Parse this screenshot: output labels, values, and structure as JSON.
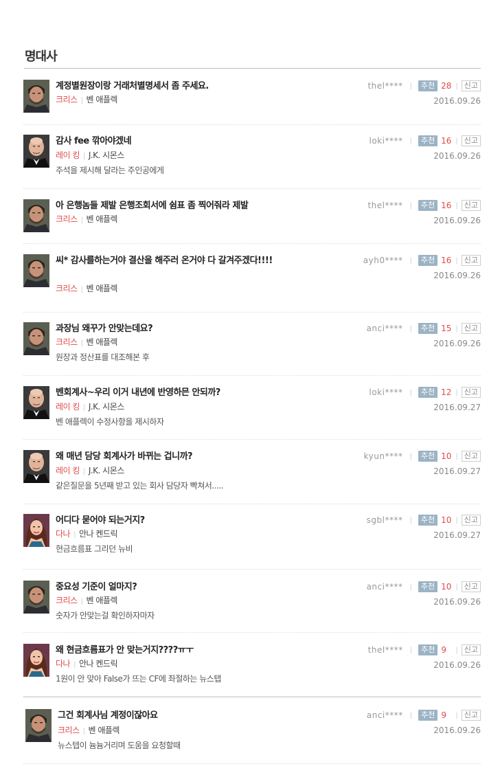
{
  "section": {
    "title": "명대사"
  },
  "labels": {
    "recommend": "추천",
    "report": "신고"
  },
  "colors": {
    "role": "#e04a4a",
    "recommend_bg": "#9bb3c4"
  },
  "quotes": [
    {
      "text": "계정별원장이랑 거래처별명세서 좀 주세요.",
      "role": "크리스",
      "actor": "벤 애플렉",
      "desc": "",
      "user": "thel****",
      "recommend": "28",
      "date": "2016.09.26",
      "avatar": "ben-affleck-photo"
    },
    {
      "text": "감사 fee 깎아야겠네",
      "role": "레이 킹",
      "actor": "J.K. 시몬스",
      "desc": "주석을 제시해 달라는 주인공에게",
      "user": "loki****",
      "recommend": "16",
      "date": "2016.09.26",
      "avatar": "jk-simmons-photo"
    },
    {
      "text": "아 은행놈들 제발 은행조회서에 쉼표 좀 찍어줘라 제발",
      "role": "크리스",
      "actor": "벤 애플렉",
      "desc": "",
      "user": "thel****",
      "recommend": "16",
      "date": "2016.09.26",
      "avatar": "ben-affleck-photo"
    },
    {
      "text": "씨* 감사를하는거야 결산을 해주러 온거야 다 갈겨주겠다!!!!",
      "role": "크리스",
      "actor": "벤 애플렉",
      "desc": "",
      "user": "ayh0****",
      "recommend": "16",
      "date": "2016.09.26",
      "avatar": "ben-affleck-photo"
    },
    {
      "text": "과장님 왜꾸가 안맞는데요?",
      "role": "크리스",
      "actor": "벤 애플렉",
      "desc": "원장과 정산표를 대조해본 후",
      "user": "anci****",
      "recommend": "15",
      "date": "2016.09.26",
      "avatar": "ben-affleck-photo"
    },
    {
      "text": "벤회계사~우리 이거 내년에 반영하믄 안되까?",
      "role": "레이 킹",
      "actor": "J.K. 시몬스",
      "desc": "벤 애플렉이 수정사항을 제시하자",
      "user": "loki****",
      "recommend": "12",
      "date": "2016.09.27",
      "avatar": "jk-simmons-photo"
    },
    {
      "text": "왜 매년 담당 회계사가 바뀌는 겁니까?",
      "role": "레이 킹",
      "actor": "J.K. 시몬스",
      "desc": "같은질문을 5년째 받고 있는 회사 담당자 빡쳐서.....",
      "user": "kyun****",
      "recommend": "10",
      "date": "2016.09.27",
      "avatar": "jk-simmons-photo"
    },
    {
      "text": "어디다 묻어야 되는거지?",
      "role": "다나",
      "actor": "안나 켄드릭",
      "desc": "현금흐름표 그리던 뉴비",
      "user": "sgbl****",
      "recommend": "10",
      "date": "2016.09.27",
      "avatar": "anna-kendrick-photo"
    },
    {
      "text": "중요성 기준이 얼마지?",
      "role": "크리스",
      "actor": "벤 애플렉",
      "desc": "숫자가 안맞는걸 확인하자마자",
      "user": "anci****",
      "recommend": "10",
      "date": "2016.09.26",
      "avatar": "ben-affleck-photo"
    },
    {
      "text": "왜 현금흐름표가 안 맞는거지????ㅠㅜ",
      "role": "다나",
      "actor": "안나 켄드릭",
      "desc": "1원이 안 맞아 False가 뜨는 CF에 좌절하는 뉴스탭",
      "user": "thel****",
      "recommend": "9",
      "date": "2016.09.26",
      "avatar": "anna-kendrick-photo"
    },
    {
      "text": "그건 회계사님 계정이잖아요",
      "role": "크리스",
      "actor": "벤 애플렉",
      "desc": "뉴스텝이 늄늄거리며 도움을 요청할때",
      "user": "anci****",
      "recommend": "9",
      "date": "2016.09.26",
      "avatar": "ben-affleck-photo"
    }
  ]
}
